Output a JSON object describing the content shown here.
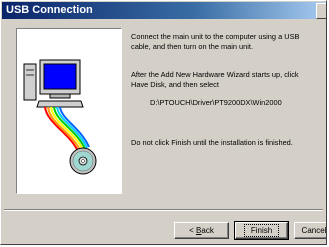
{
  "window": {
    "title": "USB Connection"
  },
  "instructions": {
    "line1": "Connect the main unit to the computer using a USB",
    "line2": "cable, and then turn on the main unit.",
    "line3": "After the Add New Hardware Wizard starts up, click",
    "line4": "Have Disk, and then select",
    "path": "D:\\PTOUCH\\Driver\\PT9200DX\\Win2000",
    "warning": "Do not click Finish until the installation is finished."
  },
  "buttons": {
    "back_prefix": "< ",
    "back_accel": "B",
    "back_rest": "ack",
    "finish": "Finish",
    "cancel": "Cancel"
  },
  "icons": {
    "illustration": "computer-usb-cd-icon"
  }
}
